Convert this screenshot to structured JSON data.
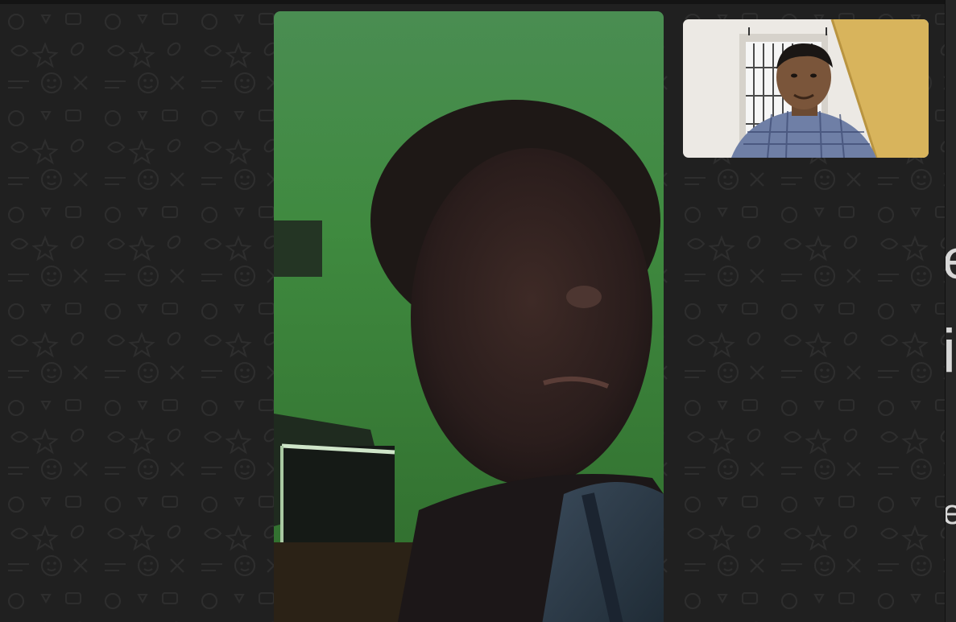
{
  "app": {
    "screen": "video-call"
  },
  "call": {
    "remote_video_label": "",
    "self_view_label": ""
  },
  "side_panel": {
    "clipped_glyphs": [
      "e",
      "i",
      "e"
    ]
  },
  "colors": {
    "background": "#202020",
    "doodle_stroke": "#2f2f2f",
    "remote_wall": "#3f8a3f",
    "self_wall": "#e9e7e2",
    "self_door": "#d6b25a"
  },
  "icons": [
    "chat-doodle-pattern"
  ]
}
